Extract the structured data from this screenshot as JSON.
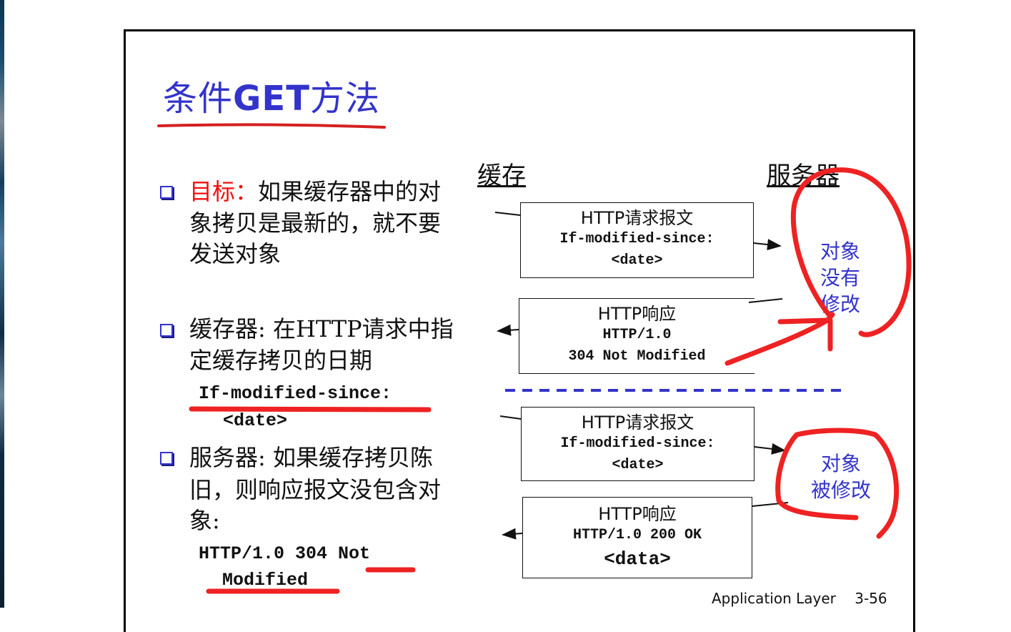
{
  "slide": {
    "title_prefix": "条件",
    "title_get": "GET",
    "title_suffix": "方法",
    "bullets": [
      {
        "label": "目标：",
        "lines": [
          "如果缓存器中的对",
          "象拷贝是最新的，就不要",
          "发送对象"
        ]
      },
      {
        "lines": [
          "缓存器: 在HTTP请求中指",
          "定缓存拷贝的日期"
        ],
        "code_lines": [
          "If-modified-since:",
          "<date>"
        ]
      },
      {
        "lines": [
          "服务器: 如果缓存拷贝陈",
          "旧，则响应报文没包含对",
          "象:"
        ],
        "code_lines": [
          "HTTP/1.0 304 Not",
          "Modified"
        ]
      }
    ],
    "diagram": {
      "cache_label": "缓存",
      "server_label": "服务器",
      "scenario1": {
        "request": {
          "header": "HTTP请求报文",
          "line1": "If-modified-since:",
          "line2": "<date>"
        },
        "response": {
          "header": "HTTP响应",
          "line1": "HTTP/1.0",
          "line2": "304 Not Modified"
        },
        "server_note": [
          "对象",
          "没有",
          "修改"
        ]
      },
      "scenario2": {
        "request": {
          "header": "HTTP请求报文",
          "line1": "If-modified-since:",
          "line2": "<date>"
        },
        "response": {
          "header": "HTTP响应",
          "line1": "HTTP/1.0 200 OK",
          "line2": "<data>"
        },
        "server_note": [
          "对象",
          "被修改"
        ]
      }
    },
    "footer": {
      "section": "Application Layer",
      "page": "3-56"
    }
  },
  "colors": {
    "title": "#3333cc",
    "highlight": "#ee1111",
    "annotation": "#ee2222",
    "divider": "#3333cc"
  }
}
